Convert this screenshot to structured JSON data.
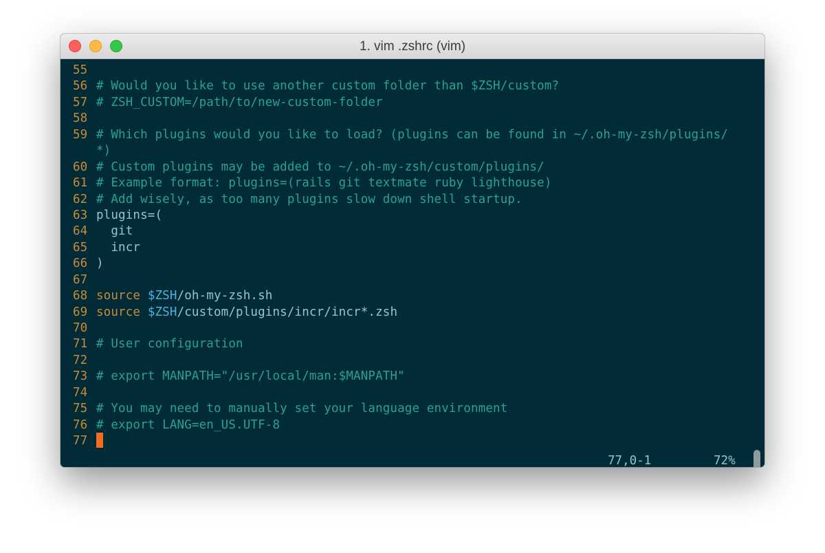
{
  "window": {
    "title": "1. vim .zshrc (vim)"
  },
  "editor": {
    "lines": [
      {
        "num": "55",
        "parts": []
      },
      {
        "num": "56",
        "parts": [
          {
            "t": "# Would you like to use another custom folder than $ZSH/custom?",
            "c": "cm"
          }
        ]
      },
      {
        "num": "57",
        "parts": [
          {
            "t": "# ZSH_CUSTOM=/path/to/new-custom-folder",
            "c": "cm"
          }
        ]
      },
      {
        "num": "58",
        "parts": []
      },
      {
        "num": "59",
        "parts": [
          {
            "t": "# Which plugins would you like to load? (plugins can be found in ~/.oh-my-zsh/plugins/",
            "c": "cm"
          }
        ]
      },
      {
        "num": "",
        "parts": [
          {
            "t": "*)",
            "c": "cm"
          }
        ]
      },
      {
        "num": "60",
        "parts": [
          {
            "t": "# Custom plugins may be added to ~/.oh-my-zsh/custom/plugins/",
            "c": "cm"
          }
        ]
      },
      {
        "num": "61",
        "parts": [
          {
            "t": "# Example format: plugins=(rails git textmate ruby lighthouse)",
            "c": "cm"
          }
        ]
      },
      {
        "num": "62",
        "parts": [
          {
            "t": "# Add wisely, as too many plugins slow down shell startup.",
            "c": "cm"
          }
        ]
      },
      {
        "num": "63",
        "parts": [
          {
            "t": "plugins=(",
            "c": "tx"
          }
        ]
      },
      {
        "num": "64",
        "parts": [
          {
            "t": "  git",
            "c": "tx"
          }
        ]
      },
      {
        "num": "65",
        "parts": [
          {
            "t": "  incr",
            "c": "tx"
          }
        ]
      },
      {
        "num": "66",
        "parts": [
          {
            "t": ")",
            "c": "tx"
          }
        ]
      },
      {
        "num": "67",
        "parts": []
      },
      {
        "num": "68",
        "parts": [
          {
            "t": "source ",
            "c": "kw"
          },
          {
            "t": "$ZSH",
            "c": "vr"
          },
          {
            "t": "/oh-my-zsh.sh",
            "c": "tx"
          }
        ]
      },
      {
        "num": "69",
        "parts": [
          {
            "t": "source ",
            "c": "kw"
          },
          {
            "t": "$ZSH",
            "c": "vr"
          },
          {
            "t": "/custom/plugins/incr/incr*.zsh",
            "c": "tx"
          }
        ]
      },
      {
        "num": "70",
        "parts": []
      },
      {
        "num": "71",
        "parts": [
          {
            "t": "# User configuration",
            "c": "cm"
          }
        ]
      },
      {
        "num": "72",
        "parts": []
      },
      {
        "num": "73",
        "parts": [
          {
            "t": "# export MANPATH=\"/usr/local/man:$MANPATH\"",
            "c": "cm"
          }
        ]
      },
      {
        "num": "74",
        "parts": []
      },
      {
        "num": "75",
        "parts": [
          {
            "t": "# You may need to manually set your language environment",
            "c": "cm"
          }
        ]
      },
      {
        "num": "76",
        "parts": [
          {
            "t": "# export LANG=en_US.UTF-8",
            "c": "cm"
          }
        ]
      },
      {
        "num": "77",
        "parts": [],
        "cursor": true
      }
    ],
    "status": {
      "position": "77,0-1",
      "percent": "72%"
    }
  },
  "colors": {
    "background": "#012b36",
    "line_number": "#c98b3a",
    "comment": "#2aa198",
    "text": "#93c8c8",
    "keyword": "#c98b3a",
    "variable": "#4cb4e0",
    "cursor": "#f26d21"
  }
}
